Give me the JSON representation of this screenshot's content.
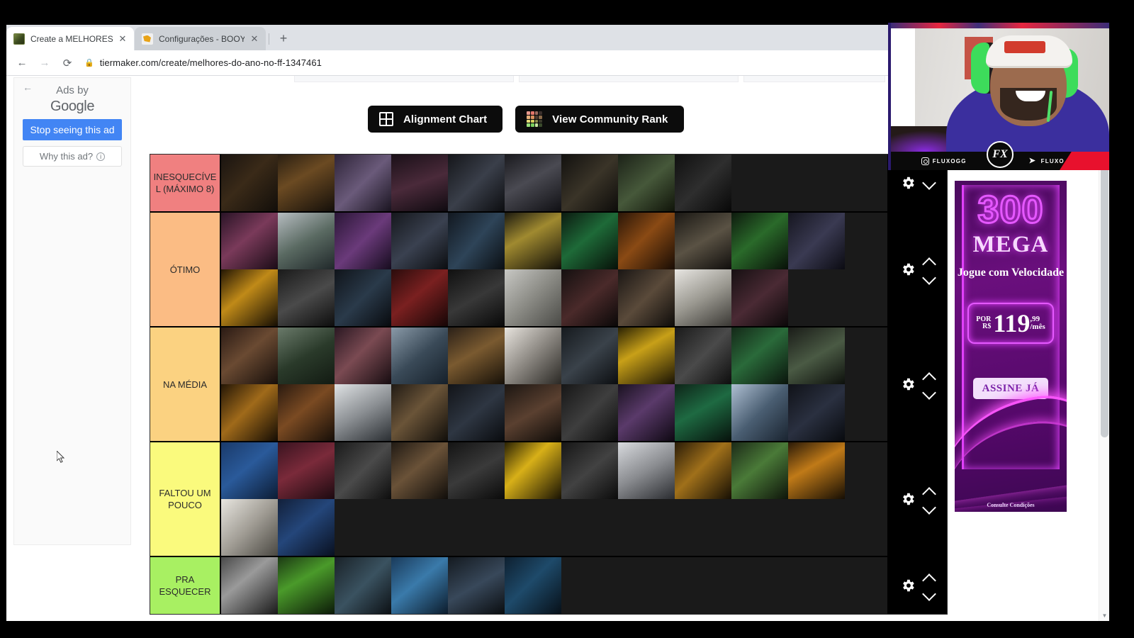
{
  "browser": {
    "tabs": [
      {
        "title": "Create a MELHORES DO ANO N",
        "favicon": "tiermaker-icon",
        "active": true,
        "close_label": "✕"
      },
      {
        "title": "Configurações - BOOYAH!",
        "favicon": "booyah-icon",
        "active": false,
        "close_label": "✕"
      }
    ],
    "new_tab_label": "+",
    "nav": {
      "back": "←",
      "forward": "→",
      "reload": "⟳"
    },
    "omnibox": {
      "lock": "🔒",
      "url": "tiermaker.com/create/melhores-do-ano-no-ff-1347461"
    }
  },
  "ad_sidebar": {
    "back_arrow": "←",
    "ads_by_line1": "Ads by",
    "ads_by_line2": "Google",
    "stop_button": "Stop seeing this ad",
    "why_button": "Why this ad?",
    "why_info_icon": "i",
    "accent_blue": "#4285f4"
  },
  "tiermaker": {
    "actions": [
      {
        "label": "Alignment Chart",
        "icon": "grid-2x2-icon"
      },
      {
        "label": "View Community Rank",
        "icon": "color-grid-icon"
      }
    ],
    "community_icon_colors": [
      "#e8998d",
      "#e3756a",
      "#9c6a5e",
      "#3a2f2c",
      "#e8b07a",
      "#d98f5e",
      "#4a3a30",
      "#8a6a4a",
      "#e8e07a",
      "#d9d05e",
      "#8a8a4a",
      "#3a3a2c",
      "#9ae07a",
      "#7ad05e",
      "#c8e8a0",
      "#3a4a2c"
    ],
    "tiers": [
      {
        "label": "INESQUECÍVEL (MÁXIMO 8)",
        "color": "#f08080",
        "rows": 1,
        "items": [
          {
            "bg": "linear-gradient(135deg,#1a1410 0%,#3a2a18 45%,#120e0a 100%)"
          },
          {
            "bg": "linear-gradient(150deg,#2a1f12 0%,#6b4a22 40%,#140f0a 100%)"
          },
          {
            "bg": "linear-gradient(135deg,#2e2438 0%,#6a5a7a 50%,#1a1420 100%)"
          },
          {
            "bg": "linear-gradient(160deg,#1a1018 0%,#4a2a3a 50%,#0f0a10 100%)"
          },
          {
            "bg": "linear-gradient(135deg,#15161a 0%,#3a3f4a 50%,#0c0d10 100%)"
          },
          {
            "bg": "linear-gradient(150deg,#1a1a1e 0%,#4a4a52 45%,#101014 100%)"
          },
          {
            "bg": "linear-gradient(135deg,#12110f 0%,#3a3428 50%,#0d0c0a 100%)"
          },
          {
            "bg": "linear-gradient(140deg,#1c2218 0%,#46583a 50%,#101409 100%)"
          },
          {
            "bg": "linear-gradient(135deg,#101010 0%,#2e2e2e 50%,#080808 100%)"
          }
        ]
      },
      {
        "label": "ÓTIMO",
        "color": "#fbbc84",
        "rows": 2,
        "items": [
          {
            "bg": "linear-gradient(140deg,#2a1426 0%,#7a3a5a 45%,#1a0c16 100%)"
          },
          {
            "bg": "linear-gradient(150deg,#b6bcc0 0%,#5a6a62 50%,#20282a 100%)"
          },
          {
            "bg": "linear-gradient(135deg,#2a1636 0%,#6a3a7a 50%,#160c1e 100%)"
          },
          {
            "bg": "linear-gradient(140deg,#15171c 0%,#3a4150 50%,#0b0d10 100%)"
          },
          {
            "bg": "linear-gradient(130deg,#121820 0%,#2e4458 50%,#0a0e12 100%)"
          },
          {
            "bg": "linear-gradient(150deg,#1c1a10 0%,#a08a30 40%,#120f08 100%)"
          },
          {
            "bg": "linear-gradient(140deg,#0c1a10 0%,#1e6a38 45%,#071008 100%)"
          },
          {
            "bg": "linear-gradient(135deg,#2a1608 0%,#8a4a14 45%,#180c04 100%)"
          },
          {
            "bg": "linear-gradient(150deg,#1a1814 0%,#5a5244 50%,#100e0c 100%)"
          },
          {
            "bg": "linear-gradient(140deg,#0e1a0e 0%,#2a6a2a 45%,#081008 100%)"
          },
          {
            "bg": "linear-gradient(135deg,#161620 0%,#3a3a52 50%,#0b0b12 100%)"
          },
          {
            "bg": "linear-gradient(140deg,#231604 0%,#c08a18 42%,#160e04 100%)"
          },
          {
            "bg": "linear-gradient(150deg,#1a1a1a 0%,#4a4a4a 50%,#0d0d0d 100%)"
          },
          {
            "bg": "linear-gradient(135deg,#10141a 0%,#2a3a4a 50%,#080a0e 100%)"
          },
          {
            "bg": "linear-gradient(140deg,#2a0c0c 0%,#7a2020 45%,#160606 100%)"
          },
          {
            "bg": "linear-gradient(150deg,#101010 0%,#383838 50%,#080808 100%)"
          },
          {
            "bg": "linear-gradient(135deg,#c8c8c4 0%,#8a8a84 50%,#4a4a46 100%)"
          },
          {
            "bg": "linear-gradient(140deg,#141010 0%,#4a2a2a 50%,#0a0808 100%)"
          },
          {
            "bg": "linear-gradient(135deg,#1a1614 0%,#5a4a3a 50%,#0e0c0a 100%)"
          },
          {
            "bg": "linear-gradient(150deg,#e8e6e2 0%,#9a9890 50%,#3a3834 100%)"
          },
          {
            "bg": "linear-gradient(140deg,#161012 0%,#4a2a34 50%,#0b0809 100%)"
          }
        ]
      },
      {
        "label": "NA MÉDIA",
        "color": "#fbd281",
        "rows": 2,
        "items": [
          {
            "bg": "linear-gradient(140deg,#2a1a14 0%,#6a4a32 45%,#160e0a 100%)"
          },
          {
            "bg": "linear-gradient(150deg,#6a7a6a 0%,#2a3a2a 50%,#121a12 100%)"
          },
          {
            "bg": "linear-gradient(135deg,#2a1822 0%,#7a4a52 45%,#160c10 100%)"
          },
          {
            "bg": "linear-gradient(140deg,#8a9aa8 0%,#3a4a58 50%,#16202a 100%)"
          },
          {
            "bg": "linear-gradient(150deg,#2a2018 0%,#7a5a30 45%,#161008 100%)"
          },
          {
            "bg": "linear-gradient(135deg,#e8e4de 0%,#8a8680 50%,#2a2824 100%)"
          },
          {
            "bg": "linear-gradient(140deg,#161a1e 0%,#3a424a 50%,#0b0d10 100%)"
          },
          {
            "bg": "linear-gradient(150deg,#2a2204 0%,#c8a018 40%,#181204 100%)"
          },
          {
            "bg": "linear-gradient(135deg,#1a1a1a 0%,#4a4a4a 50%,#0d0d0d 100%)"
          },
          {
            "bg": "linear-gradient(140deg,#142818 0%,#2a6a3a 45%,#0a140c 100%)"
          },
          {
            "bg": "linear-gradient(150deg,#1a1c18 0%,#4a5a44 50%,#0d100c 100%)"
          },
          {
            "bg": "linear-gradient(135deg,#241606 0%,#a06a1a 45%,#140c04 100%)"
          },
          {
            "bg": "linear-gradient(140deg,#2a1a10 0%,#7a4a22 45%,#160e08 100%)"
          },
          {
            "bg": "linear-gradient(150deg,#dfe2e4 0%,#8a8e92 50%,#2a2e32 100%)"
          },
          {
            "bg": "linear-gradient(135deg,#201a14 0%,#6a5438 45%,#110e0a 100%)"
          },
          {
            "bg": "linear-gradient(140deg,#121418 0%,#2e3642 50%,#090b0e 100%)"
          },
          {
            "bg": "linear-gradient(150deg,#1c1612 0%,#5a4030 50%,#0e0b08 100%)"
          },
          {
            "bg": "linear-gradient(135deg,#161616 0%,#3e3e3e 50%,#0b0b0b 100%)"
          },
          {
            "bg": "linear-gradient(140deg,#1a1220 0%,#5a3a6a 45%,#0e0812 100%)"
          },
          {
            "bg": "linear-gradient(150deg,#0e2418 0%,#1e6a42 45%,#07120c 100%)"
          },
          {
            "bg": "linear-gradient(135deg,#aebfd2 0%,#4a5e72 50%,#1a2430 100%)"
          },
          {
            "bg": "linear-gradient(140deg,#101218 0%,#2a3040 50%,#080a0e 100%)"
          }
        ]
      },
      {
        "label": "FALTOU UM POUCO",
        "color": "#fafa7d",
        "rows": 2,
        "items": [
          {
            "bg": "linear-gradient(140deg,#1a3a6a 0%,#2a5a9a 45%,#0c1c34 100%)"
          },
          {
            "bg": "linear-gradient(150deg,#3a1420 0%,#7a2a3a 45%,#1c0a10 100%)"
          },
          {
            "bg": "linear-gradient(135deg,#1a1a1a 0%,#4a4a4a 50%,#0d0d0d 100%)"
          },
          {
            "bg": "linear-gradient(140deg,#201a14 0%,#6a5238 45%,#100d0a 100%)"
          },
          {
            "bg": "linear-gradient(150deg,#141414 0%,#3a3a3a 50%,#0a0a0a 100%)"
          },
          {
            "bg": "linear-gradient(135deg,#2a2204 0%,#d8b018 40%,#181204 100%)"
          },
          {
            "bg": "linear-gradient(140deg,#161616 0%,#424242 50%,#0b0b0b 100%)"
          },
          {
            "bg": "linear-gradient(150deg,#d8dade 0%,#8a8c90 50%,#2a2c30 100%)"
          },
          {
            "bg": "linear-gradient(135deg,#2a1c08 0%,#a0701a 45%,#160f04 100%)"
          },
          {
            "bg": "linear-gradient(140deg,#1c2a18 0%,#4a7a38 45%,#0e140a 100%)"
          },
          {
            "bg": "linear-gradient(150deg,#2a1a08 0%,#c07a18 42%,#160e04 100%)"
          },
          {
            "bg": "linear-gradient(135deg,#e8e6e0 0%,#a09c94 50%,#4a4842 100%)"
          },
          {
            "bg": "linear-gradient(140deg,#12203a 0%,#24467a 45%,#091020 100%)"
          }
        ]
      },
      {
        "label": "PRA ESQUECER",
        "color": "#a8f062",
        "rows": 1,
        "items": [
          {
            "bg": "linear-gradient(140deg,#4a4a4a 0%,#9a9a9a 40%,#1a1a1a 100%)"
          },
          {
            "bg": "linear-gradient(150deg,#1c3a14 0%,#4a9a2a 40%,#0c1a08 100%)"
          },
          {
            "bg": "linear-gradient(135deg,#1a2228 0%,#3a5260 50%,#0c1014 100%)"
          },
          {
            "bg": "linear-gradient(140deg,#1a3a5a 0%,#3a7aaa 45%,#0c1c2c 100%)"
          },
          {
            "bg": "linear-gradient(150deg,#141a20 0%,#38485a 50%,#0a0d10 100%)"
          },
          {
            "bg": "linear-gradient(135deg,#0e2030 0%,#1e4a6a 45%,#071018 100%)"
          }
        ]
      }
    ],
    "row_controls": {
      "settings_icon": "gear-icon",
      "move_up_icon": "chevron-up-icon",
      "move_down_icon": "chevron-down-icon"
    }
  },
  "side_ad": {
    "headline_number": "300",
    "headline_unit": "MEGA",
    "tagline": "Jogue com Velocidade",
    "price_prefix_line1": "POR",
    "price_prefix_line2": "R$",
    "price_amount": "119",
    "price_cents": ",99",
    "price_period": "/mês",
    "cta": "ASSINE JÁ",
    "terms": "Consulte Condições",
    "accent": "#e040fb"
  },
  "webcam": {
    "instagram_handle": "FLUXOGG",
    "twitter_handle": "FLUXO_GG",
    "logo_text": "FX"
  },
  "scrollbar": {
    "up_arrow": "▲",
    "down_arrow": "▼"
  }
}
